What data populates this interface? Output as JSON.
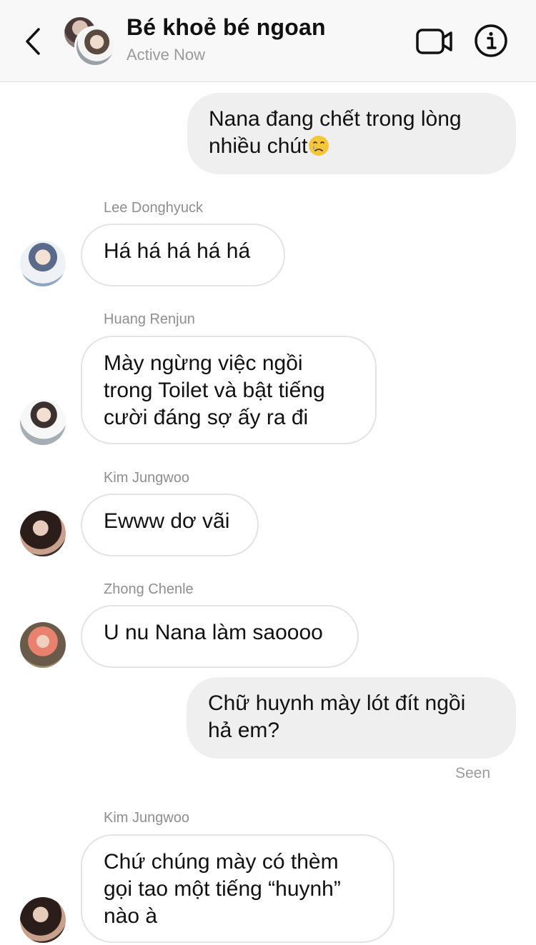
{
  "header": {
    "title": "Bé khoẻ bé ngoan",
    "status": "Active Now",
    "back_icon": "chevron-left-icon",
    "video_icon": "video-camera-icon",
    "info_icon": "info-icon"
  },
  "messages": [
    {
      "direction": "outgoing",
      "text": "Nana đang chết trong lòng nhiều chút",
      "emoji": "crying-face"
    },
    {
      "direction": "incoming",
      "sender": "Lee Donghyuck",
      "text": "Há há há há há"
    },
    {
      "direction": "incoming",
      "sender": "Huang Renjun",
      "text": "Mày ngừng việc ngồi trong Toilet và bật tiếng cười đáng sợ ấy ra đi"
    },
    {
      "direction": "incoming",
      "sender": "Kim Jungwoo",
      "text": "Ewww dơ vãi"
    },
    {
      "direction": "incoming",
      "sender": "Zhong Chenle",
      "text": "U nu Nana làm saoooo"
    },
    {
      "direction": "outgoing",
      "text": "Chữ huynh mày lót đít ngồi hả em?",
      "status": "Seen"
    },
    {
      "direction": "incoming",
      "sender": "Kim Jungwoo",
      "text": "Chứ chúng mày có thèm gọi tao một tiếng “huynh” nào à"
    }
  ],
  "colors": {
    "header_bg": "#f8f8f8",
    "outgoing_bubble": "#efefef",
    "incoming_border": "#e3e3e3",
    "meta_text": "#8e8e8e"
  }
}
